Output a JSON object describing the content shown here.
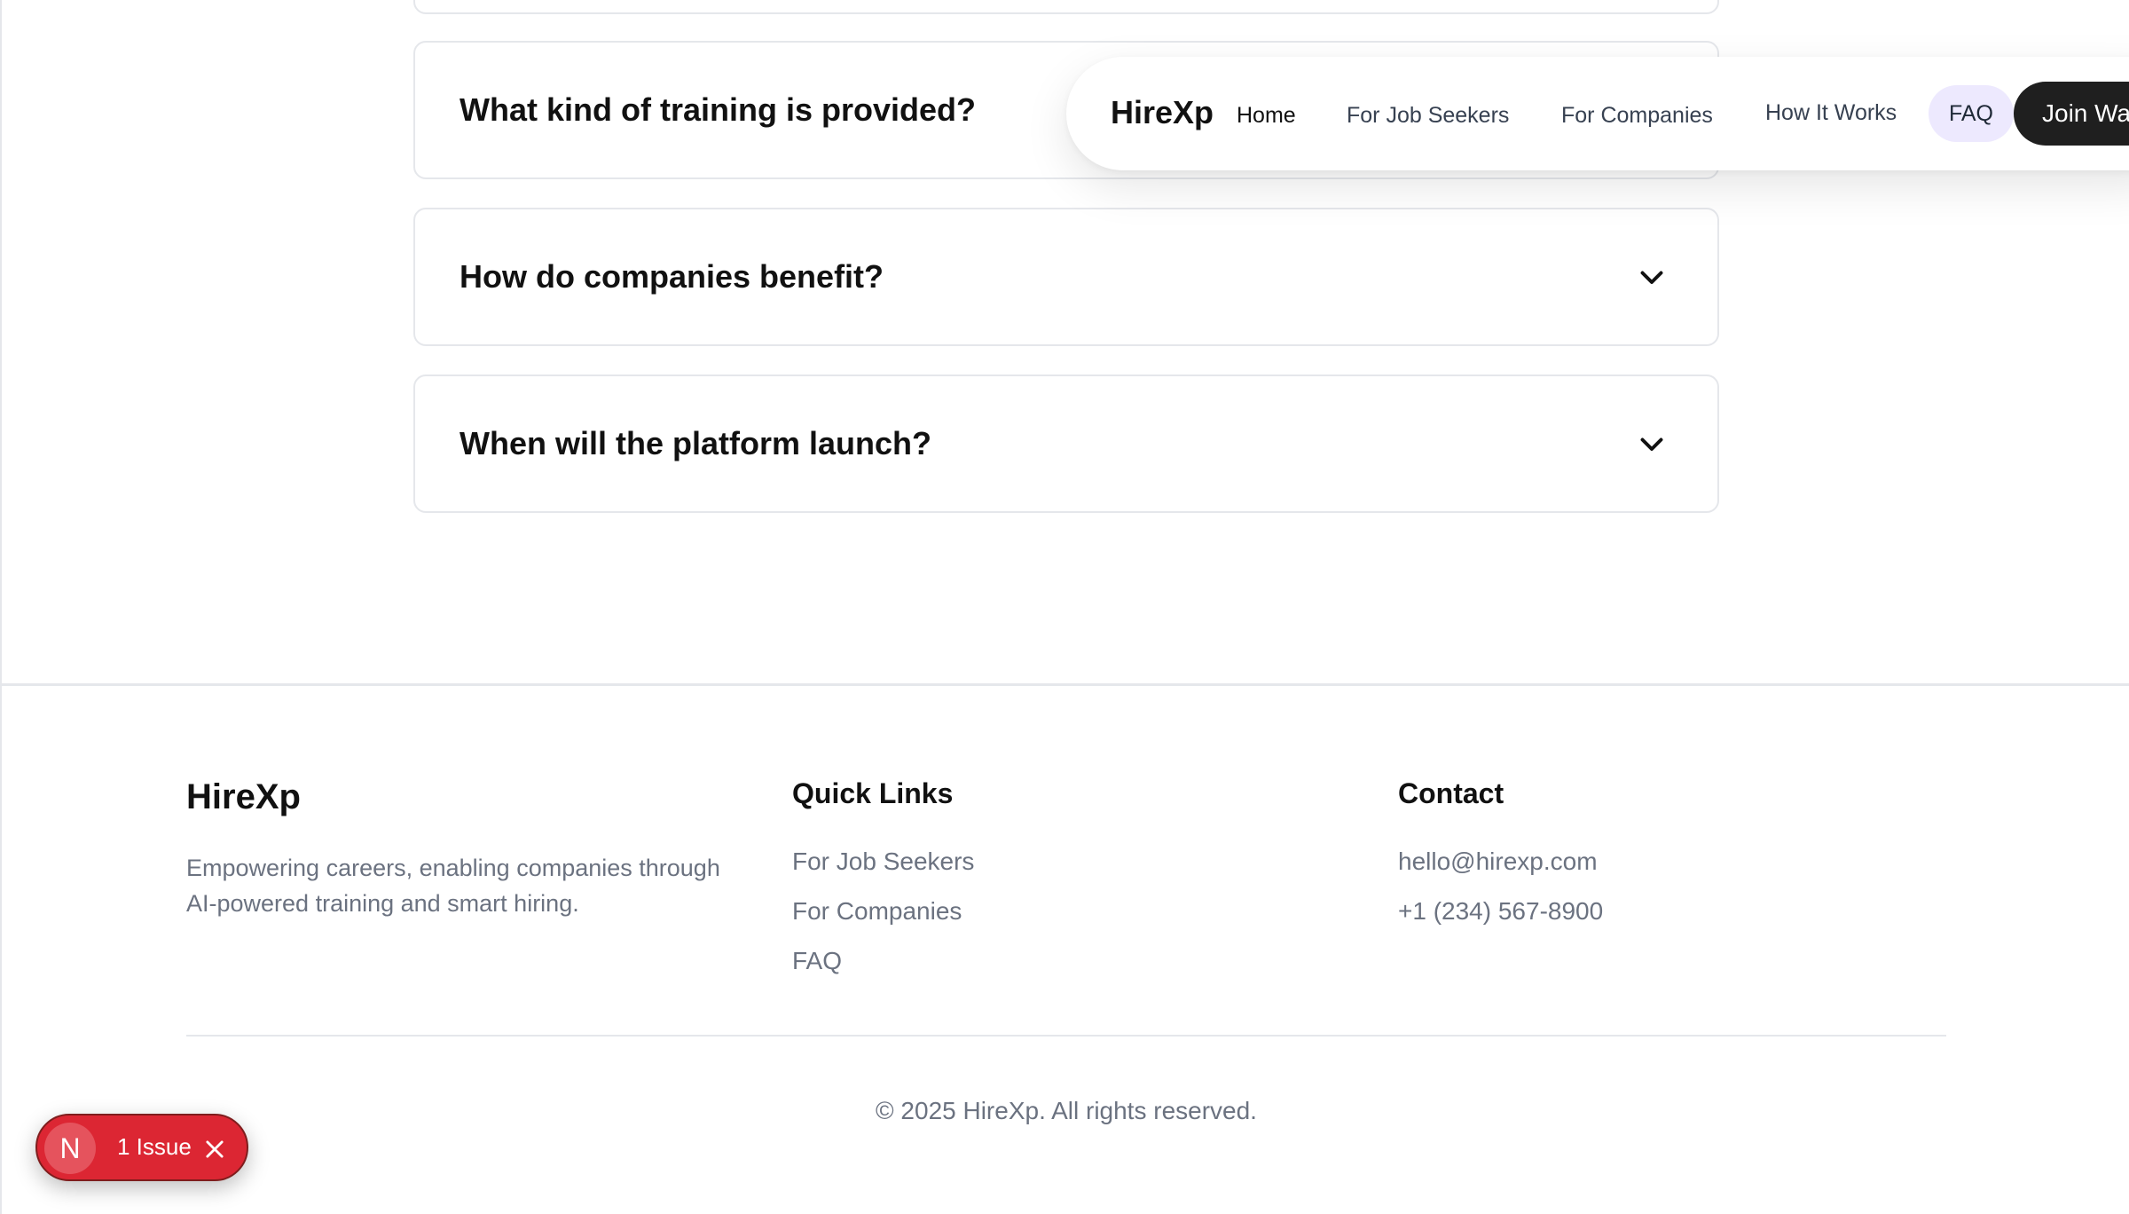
{
  "faq": {
    "items": [
      {
        "question": ""
      },
      {
        "question": "What kind of training is provided?"
      },
      {
        "question": "How do companies benefit?"
      },
      {
        "question": "When will the platform launch?"
      }
    ]
  },
  "nav": {
    "logo": "HireXp",
    "links": [
      "Home",
      "For Job Seekers",
      "For Companies",
      "How It Works",
      "FAQ"
    ],
    "cta": "Join Wa",
    "active_color": "#ede9fe"
  },
  "footer": {
    "brand": "HireXp",
    "tagline": "Empowering careers, enabling companies through AI-powered training and smart hiring.",
    "quick_links": {
      "heading": "Quick Links",
      "items": [
        "For Job Seekers",
        "For Companies",
        "FAQ"
      ]
    },
    "contact": {
      "heading": "Contact",
      "email": "hello@hirexp.com",
      "phone": "+1 (234) 567-8900"
    },
    "copyright": "© 2025 HireXp. All rights reserved."
  },
  "issue_badge": {
    "avatar_letter": "N",
    "label": "1 Issue",
    "color": "#dc2633"
  }
}
